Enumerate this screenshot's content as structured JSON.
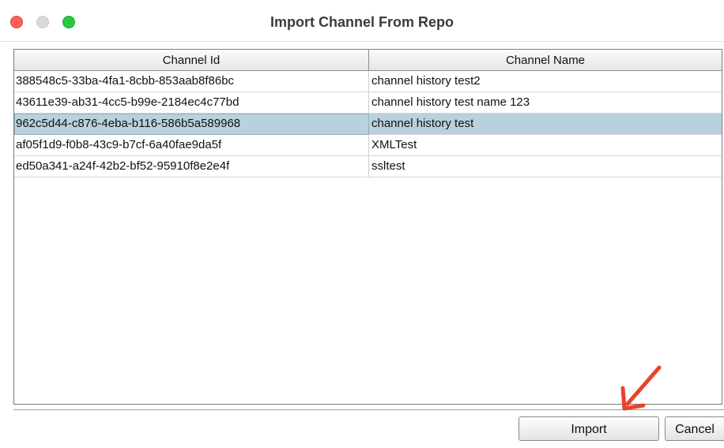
{
  "window": {
    "title": "Import Channel From Repo"
  },
  "table": {
    "columns": [
      "Channel Id",
      "Channel Name"
    ],
    "rows": [
      {
        "id": "388548c5-33ba-4fa1-8cbb-853aab8f86bc",
        "name": "channel history test2"
      },
      {
        "id": "43611e39-ab31-4cc5-b99e-2184ec4c77bd",
        "name": "channel history test name 123"
      },
      {
        "id": "962c5d44-c876-4eba-b116-586b5a589968",
        "name": "channel history test",
        "selected": true
      },
      {
        "id": "af05f1d9-f0b8-43c9-b7cf-6a40fae9da5f",
        "name": "XMLTest"
      },
      {
        "id": "ed50a341-a24f-42b2-bf52-95910f8e2e4f",
        "name": "ssltest"
      }
    ]
  },
  "buttons": {
    "import_label": "Import",
    "cancel_label": "Cancel"
  },
  "colors": {
    "selection": "#b8d1dd",
    "annotation_arrow": "#e8432a"
  },
  "annotation": {
    "icon": "red-arrow-pointing-to-import"
  }
}
